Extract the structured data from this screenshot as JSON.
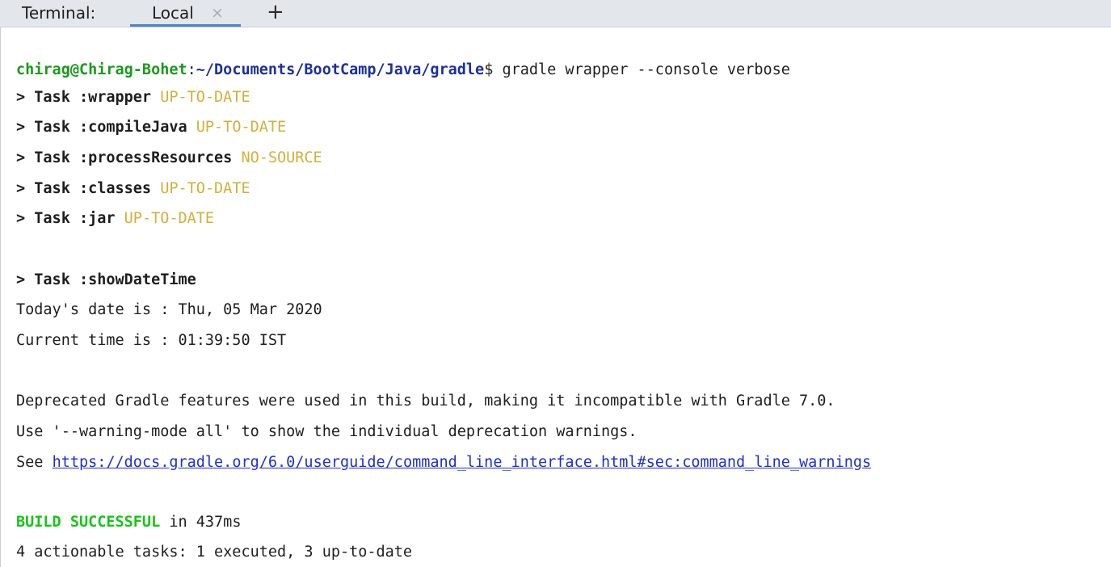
{
  "tabbar": {
    "title": "Terminal:",
    "tab_label": "Local",
    "close_glyph": "×",
    "new_tab_glyph": "+"
  },
  "prompt": {
    "user_host": "chirag@Chirag-Bohet",
    "separator": ":",
    "path": "~/Documents/BootCamp/Java/gradle",
    "symbol": "$",
    "command": " gradle wrapper --console verbose"
  },
  "tasks": [
    {
      "name": "> Task :wrapper",
      "status": "UP-TO-DATE"
    },
    {
      "name": "> Task :compileJava",
      "status": "UP-TO-DATE"
    },
    {
      "name": "> Task :processResources",
      "status": "NO-SOURCE"
    },
    {
      "name": "> Task :classes",
      "status": "UP-TO-DATE"
    },
    {
      "name": "> Task :jar",
      "status": "UP-TO-DATE"
    }
  ],
  "show_task": "> Task :showDateTime",
  "output": {
    "date_line": "Today's date is : Thu, 05 Mar 2020",
    "time_line": "Current time is : 01:39:50 IST",
    "deprecated_line": "Deprecated Gradle features were used in this build, making it incompatible with Gradle 7.0.",
    "warning_mode_line": "Use '--warning-mode all' to show the individual deprecation warnings.",
    "see_prefix": "See ",
    "see_link": "https://docs.gradle.org/6.0/userguide/command_line_interface.html#sec:command_line_warnings"
  },
  "build": {
    "status": "BUILD SUCCESSFUL",
    "duration": " in 437ms",
    "summary": "4 actionable tasks: 1 executed, 3 up-to-date"
  },
  "colors": {
    "prompt_user": "#1a9a1a",
    "prompt_path": "#1d2f9f",
    "task_status": "#d1b03a",
    "build_success": "#18c418",
    "link": "#1f2fcc",
    "tab_underline": "#4a86c7"
  }
}
